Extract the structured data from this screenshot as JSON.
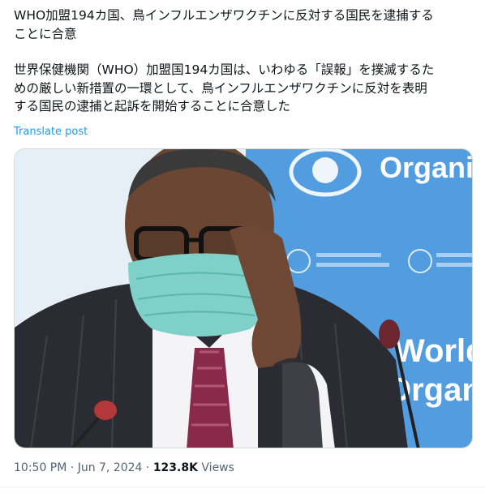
{
  "post": {
    "paragraph1": "WHO加盟194カ国、鳥インフルエンザワクチンに反対する国民を逮捕する\nことに合意",
    "paragraph2": "世界保健機関（WHO）加盟国194カ国は、いわゆる「誤報」を撲滅するた\nめの厳しい新措置の一環として、鳥インフルエンザワクチンに反対を表明\nする国民の逮捕と起訴を開始することに合意した",
    "translate_label": "Translate post"
  },
  "media": {
    "backdrop_text_top": "Organi",
    "backdrop_text_world": "World",
    "backdrop_text_organi": "Organi"
  },
  "meta": {
    "time": "10:50 PM",
    "date": "Jun 7, 2024",
    "views_count": "123.8K",
    "views_label": "Views",
    "separator": "·"
  },
  "colors": {
    "link": "#1d9bf0",
    "who_blue": "#3f8fd6",
    "mask": "#7fd0c8"
  }
}
